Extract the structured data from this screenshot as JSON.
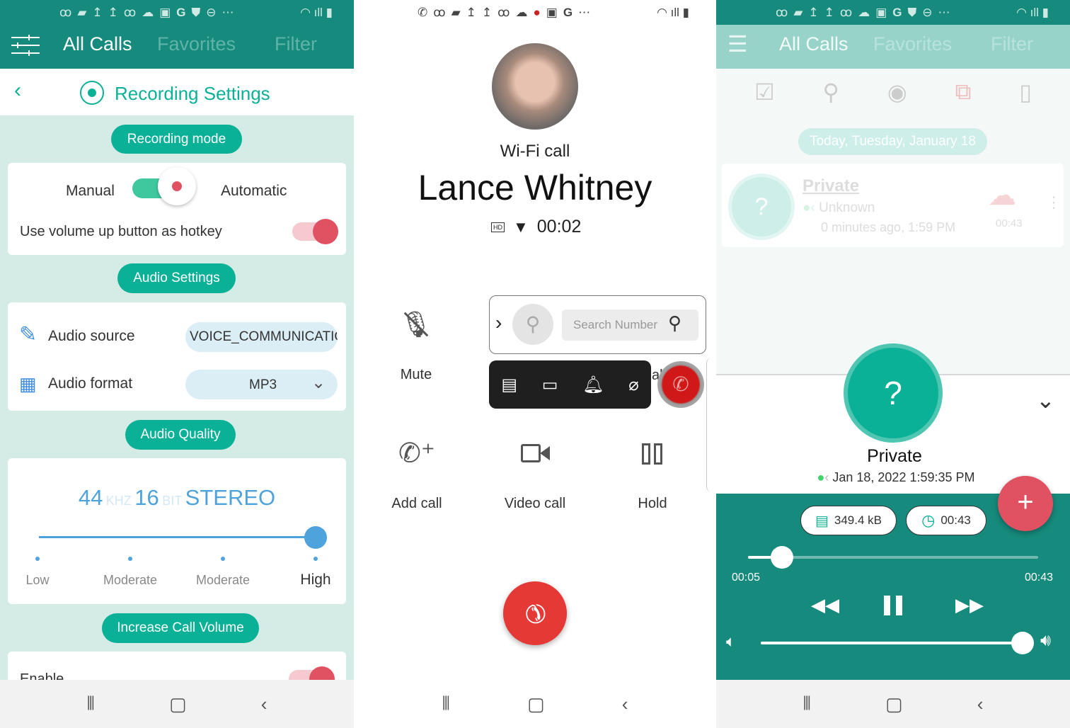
{
  "colors": {
    "teal_dark": "#168a7c",
    "teal_accent": "#0bb197",
    "red_accent": "#e05262",
    "blue_accent": "#4fa3dc",
    "settings_bg": "#d4ebe6"
  },
  "status_icons": [
    "voicemail-icon",
    "message-icon",
    "upload-icon",
    "upload-icon",
    "voicemail-icon",
    "cloud-icon",
    "image-icon",
    "google-icon",
    "bag-icon",
    "dnd-icon",
    "more-icon",
    "wifi-icon",
    "signal-icon",
    "battery-icon"
  ],
  "settings": {
    "tabs": [
      "All Calls",
      "Favorites",
      "Filter"
    ],
    "title": "Recording Settings",
    "recording_mode_label": "Recording mode",
    "manual_label": "Manual",
    "automatic_label": "Automatic",
    "mode_automatic": true,
    "hotkey_label": "Use volume up button as hotkey",
    "hotkey_enabled": true,
    "audio_settings_label": "Audio Settings",
    "audio_source_label": "Audio source",
    "audio_source_value": "VOICE_COMMUNICATIO",
    "audio_format_label": "Audio format",
    "audio_format_value": "MP3",
    "audio_quality_label": "Audio Quality",
    "quality": {
      "rate": "44",
      "rate_unit": "KHZ",
      "bits": "16",
      "bits_unit": "BIT",
      "channels": "STEREO"
    },
    "quality_levels": [
      "Low",
      "Moderate",
      "Moderate",
      "High"
    ],
    "quality_selected_index": 3,
    "increase_volume_label": "Increase Call Volume",
    "enable_label": "Enable",
    "enable_on": true
  },
  "call": {
    "call_type": "Wi-Fi call",
    "caller_name": "Lance Whitney",
    "hd_badge": "HD",
    "duration": "00:02",
    "search_placeholder": "Search Number",
    "mute_label": "Mute",
    "add_call_label": "Add call",
    "video_call_label": "Video call",
    "hold_label": "Hold",
    "partial_text": "al"
  },
  "recordings": {
    "tabs": [
      "All Calls",
      "Favorites",
      "Filter"
    ],
    "date_header": "Today, Tuesday, January 18",
    "entry": {
      "name": "Private",
      "direction": "Unknown",
      "time": "0 minutes ago, 1:59 PM",
      "duration": "00:43"
    },
    "player": {
      "name": "Private",
      "datetime": "Jan 18, 2022 1:59:35 PM",
      "file_size": "349.4 kB",
      "length": "00:43",
      "elapsed": "00:05",
      "total": "00:43",
      "progress_fraction": 0.116,
      "volume_fraction": 1.0
    }
  }
}
